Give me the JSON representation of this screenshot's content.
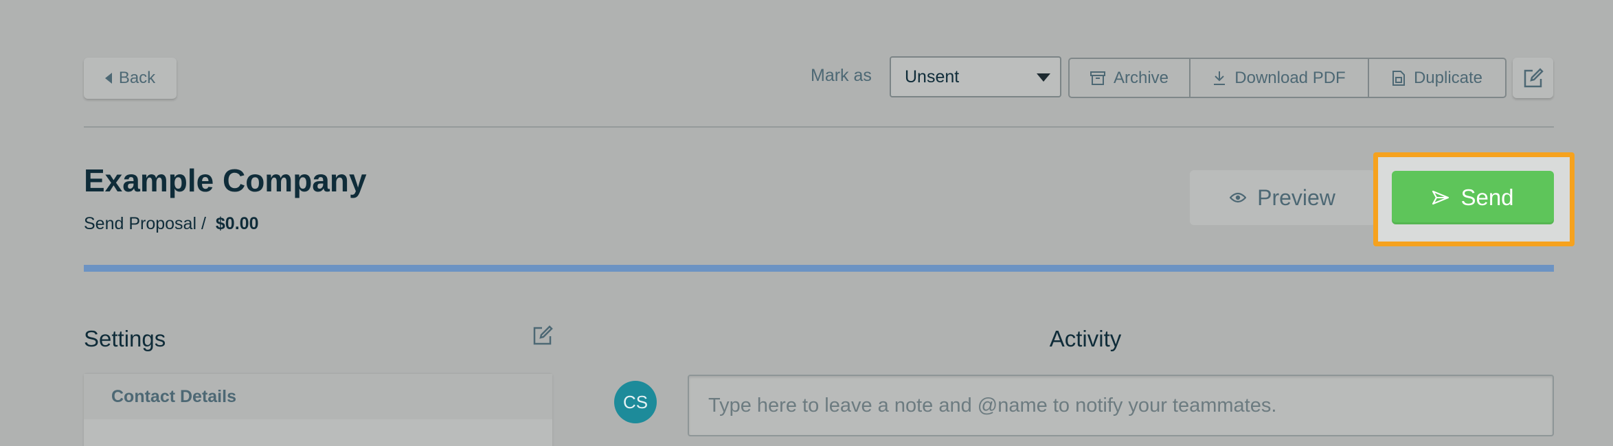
{
  "header": {
    "back_label": "Back",
    "mark_as_label": "Mark as",
    "status_value": "Unsent",
    "archive_label": "Archive",
    "download_label": "Download PDF",
    "duplicate_label": "Duplicate"
  },
  "proposal": {
    "company": "Example Company",
    "breadcrumb": "Send Proposal /",
    "amount": "$0.00",
    "preview_label": "Preview",
    "send_label": "Send"
  },
  "settings": {
    "title": "Settings",
    "contact_details": "Contact Details"
  },
  "activity": {
    "title": "Activity",
    "avatar_initials": "CS",
    "note_placeholder": "Type here to leave a note and @name to notify your teammates."
  },
  "colors": {
    "send_button": "#5ec55a",
    "highlight_frame": "#f6a21e",
    "progress_bar": "#6c93c3",
    "avatar": "#1d8b9a"
  }
}
